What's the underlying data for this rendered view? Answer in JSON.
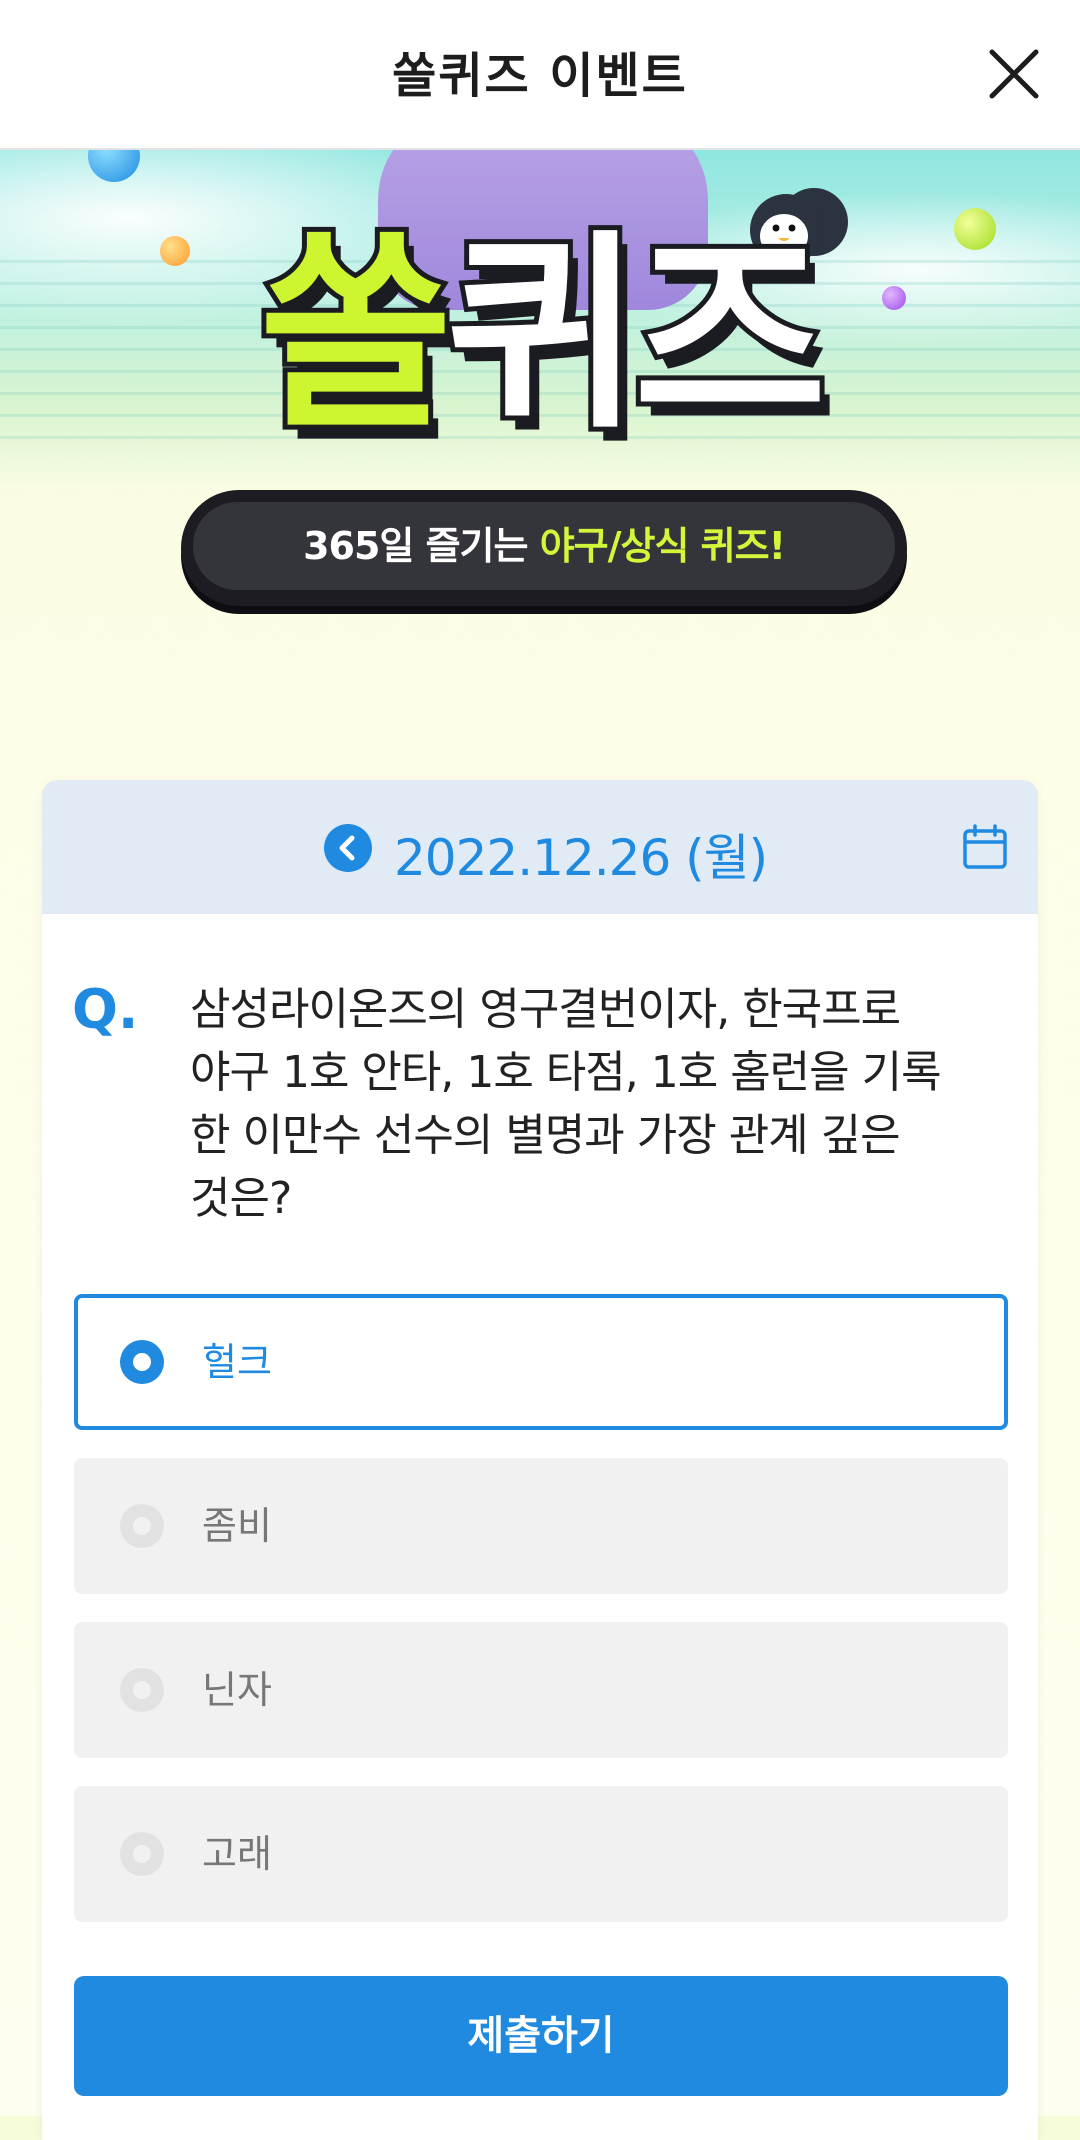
{
  "header": {
    "title": "쏠퀴즈 이벤트",
    "close_icon": "close-icon"
  },
  "banner": {
    "title_part1": "쏠",
    "title_part2": "퀴즈",
    "tagline_plain": "365일 즐기는 ",
    "tagline_highlight": "야구/상식 퀴즈!",
    "colors": {
      "title_green": "#cdf530",
      "pill_bg": "#1c1c22",
      "highlight": "#d2f73a"
    }
  },
  "quiz": {
    "date": "2022.12.26 (월)",
    "prev_icon": "chevron-left-icon",
    "calendar_icon": "calendar-icon",
    "question_mark": "Q.",
    "question_lines": [
      "삼성라이온즈의 영구결번이자, 한국프로",
      "야구 1호 안타, 1호 타점, 1호 홈런을 기록",
      "한 이만수 선수의 별명과 가장 관계 깊은",
      "것은?"
    ],
    "options": [
      {
        "label": "헐크",
        "selected": true
      },
      {
        "label": "좀비",
        "selected": false
      },
      {
        "label": "닌자",
        "selected": false
      },
      {
        "label": "고래",
        "selected": false
      }
    ],
    "submit_label": "제출하기",
    "accent_color": "#1f8ae0"
  }
}
